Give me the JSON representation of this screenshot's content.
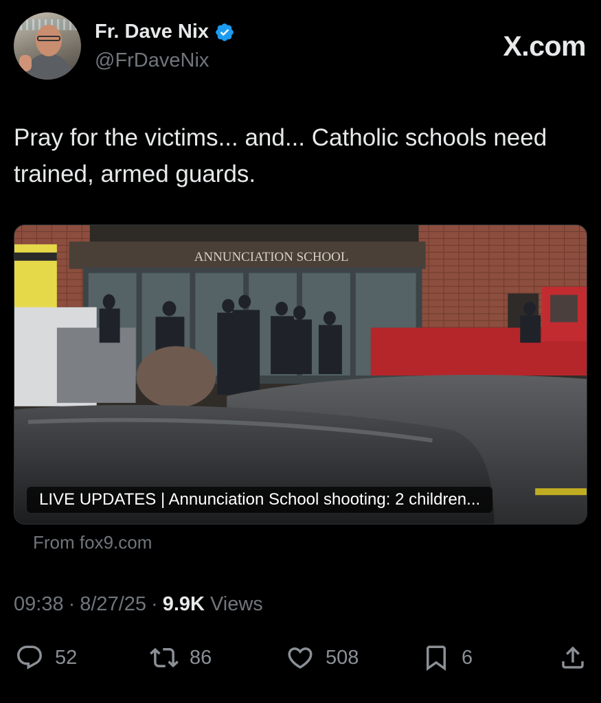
{
  "author": {
    "name": "Fr. Dave Nix",
    "handle": "@FrDaveNix",
    "verified_icon": "verified-badge-icon",
    "verified_color": "#1d9bf0"
  },
  "brand": {
    "site": "X.com"
  },
  "tweet": {
    "text": "Pray for the victims... and... Catholic schools need trained, armed guards."
  },
  "link_card": {
    "sign_text": "ANNUNCIATION SCHOOL",
    "caption": "LIVE UPDATES | Annunciation School shooting: 2 children...",
    "source": "From fox9.com"
  },
  "meta": {
    "time": "09:38",
    "separator": "·",
    "date": "8/27/25",
    "views_count": "9.9K",
    "views_label": "Views"
  },
  "actions": {
    "replies": "52",
    "reposts": "86",
    "likes": "508",
    "bookmarks": "6"
  },
  "colors": {
    "background": "#000000",
    "text_primary": "#e7e9ea",
    "text_secondary": "#71767b"
  }
}
